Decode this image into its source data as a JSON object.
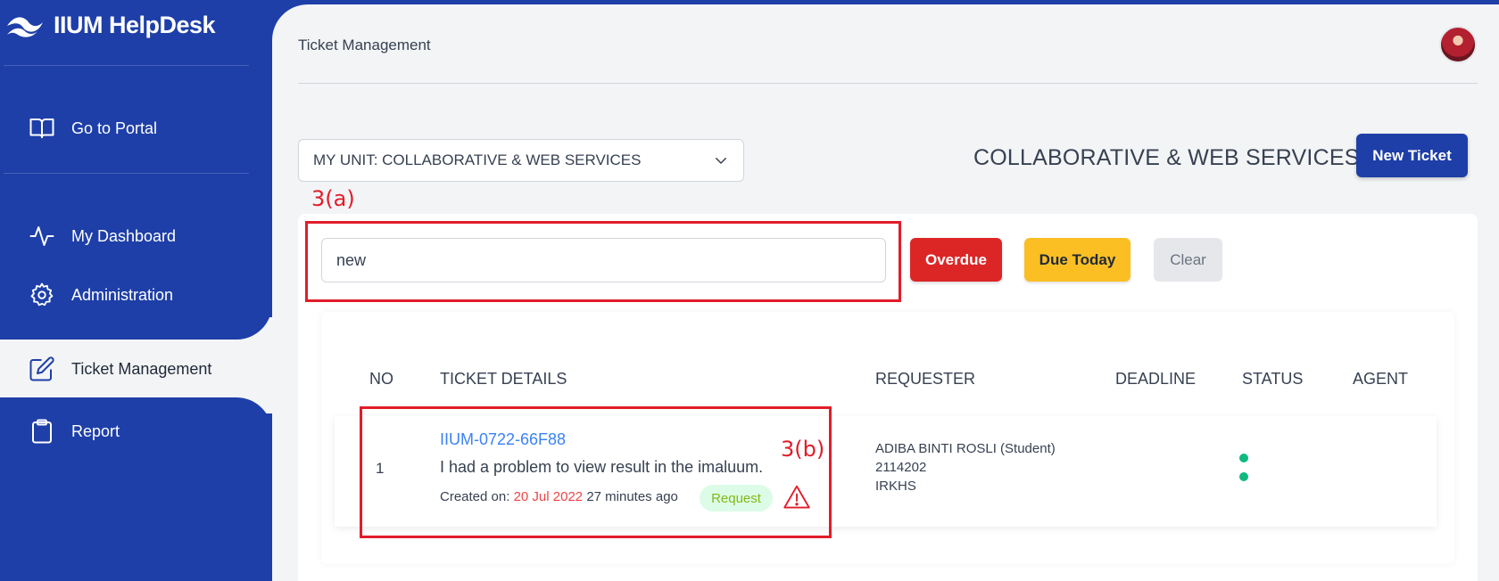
{
  "app": {
    "title": "IIUM HelpDesk"
  },
  "sidebar": {
    "items": [
      {
        "label": "Go to Portal",
        "icon": "book-open-icon"
      },
      {
        "label": "My Dashboard",
        "icon": "activity-icon"
      },
      {
        "label": "Administration",
        "icon": "gear-icon"
      },
      {
        "label": "Ticket Management",
        "icon": "edit-icon",
        "active": true
      },
      {
        "label": "Report",
        "icon": "clipboard-icon"
      }
    ]
  },
  "header": {
    "title": "Ticket Management"
  },
  "unit_select": {
    "value": "MY UNIT: COLLABORATIVE & WEB SERVICES"
  },
  "unit_heading": "COLLABORATIVE & WEB SERVICES",
  "buttons": {
    "new_ticket": "New Ticket",
    "overdue": "Overdue",
    "due_today": "Due Today",
    "clear": "Clear"
  },
  "search": {
    "value": "new"
  },
  "annotations": {
    "a": "3(a)",
    "b": "3(b)"
  },
  "table": {
    "headers": [
      "NO",
      "TICKET DETAILS",
      "REQUESTER",
      "DEADLINE",
      "STATUS",
      "AGENT"
    ],
    "rows": [
      {
        "no": "1",
        "ticket_id": "IIUM-0722-66F88",
        "description": "I had a problem to view result in the imaluum.",
        "created_label": "Created on:",
        "created_date": "20 Jul 2022",
        "created_ago": "27 minutes ago",
        "type": "Request",
        "requester_name": "ADIBA BINTI ROSLI (Student)",
        "requester_id": "2114202",
        "requester_dept": "IRKHS"
      }
    ]
  },
  "colors": {
    "brand": "#1e3fa8",
    "danger": "#dc2626",
    "warning": "#fbbf24",
    "link": "#3b82f6",
    "annotation": "#e11d2a"
  }
}
